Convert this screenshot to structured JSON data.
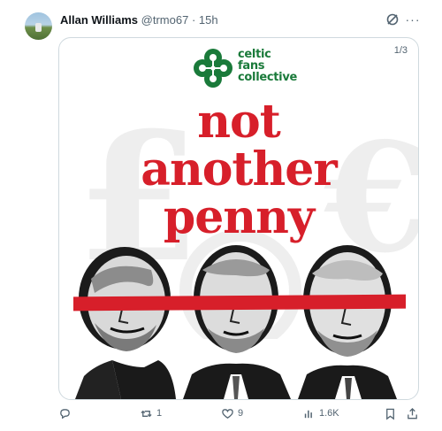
{
  "tweet": {
    "author_name": "Allan Williams",
    "handle": "@trmo67",
    "separator": "·",
    "time": "15h",
    "more_label": "···"
  },
  "media": {
    "counter": "1/3",
    "logo_lines": [
      "celtic",
      "fans",
      "collective"
    ],
    "headline_lines": [
      "not",
      "another",
      "penny"
    ]
  },
  "actions": {
    "reply_count": "",
    "repost_count": "1",
    "like_count": "9",
    "views_count": "1.6K"
  },
  "colors": {
    "brand_red": "#d71f2a",
    "celtic_green": "#1a7a3a",
    "muted_text": "#536471"
  }
}
